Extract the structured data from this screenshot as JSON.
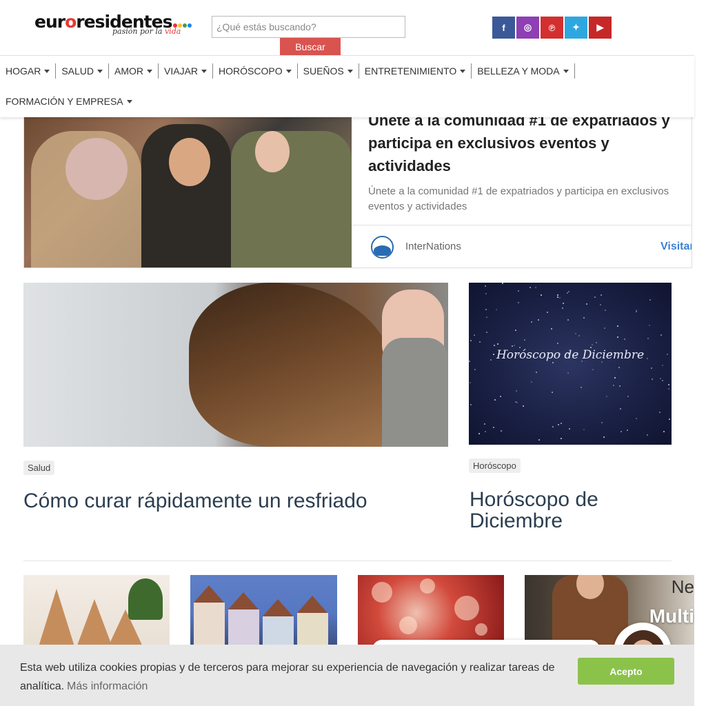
{
  "header": {
    "logo": {
      "text_pre": "eur",
      "text_o": "o",
      "text_post": "residentes",
      "tagline_pre": "pasión por la ",
      "tagline_v": "vida"
    },
    "search": {
      "placeholder": "¿Qué estás buscando?",
      "button_label": "Buscar"
    },
    "socials": [
      {
        "name": "facebook-icon",
        "glyph": "f",
        "color": "#3b5998"
      },
      {
        "name": "instagram-icon",
        "glyph": "◎",
        "color": "#8e3fb4"
      },
      {
        "name": "pinterest-icon",
        "glyph": "℗",
        "color": "#d32f2f"
      },
      {
        "name": "twitter-icon",
        "glyph": "✦",
        "color": "#2ea7e0"
      },
      {
        "name": "youtube-icon",
        "glyph": "▶",
        "color": "#c62828"
      }
    ],
    "logo_dot_colors": [
      "#e53935",
      "#fbc02d",
      "#43a047",
      "#1e88e5"
    ]
  },
  "nav": {
    "row1": [
      "HOGAR",
      "SALUD",
      "AMOR",
      "VIAJAR",
      "HORÓSCOPO",
      "SUEÑOS",
      "ENTRETENIMIENTO",
      "BELLEZA Y MODA"
    ],
    "row2": [
      "FORMACIÓN Y EMPRESA"
    ]
  },
  "ad": {
    "title": "Únete a la comunidad #1 de expatriados y participa en exclusivos eventos y actividades",
    "description": "Únete a la comunidad #1 de expatriados y participa en exclusivos eventos y actividades",
    "brand": "InterNations",
    "visit_label": "Visitar"
  },
  "articles": [
    {
      "tag": "Salud",
      "title": "Cómo curar rápidamente un resfriado"
    },
    {
      "tag": "Horóscopo",
      "title": "Horóscopo de Diciembre",
      "image_text": "Horóscopo de Diciembre"
    }
  ],
  "thumbnails": {
    "fourth_text_top": "Ne",
    "fourth_text_bottom": "Multi"
  },
  "cookie": {
    "text": "Esta web utiliza cookies propias y de terceros para mejorar su experiencia de navegación y realizar tareas de analítica.",
    "link": "Más información",
    "accept_label": "Acepto"
  }
}
